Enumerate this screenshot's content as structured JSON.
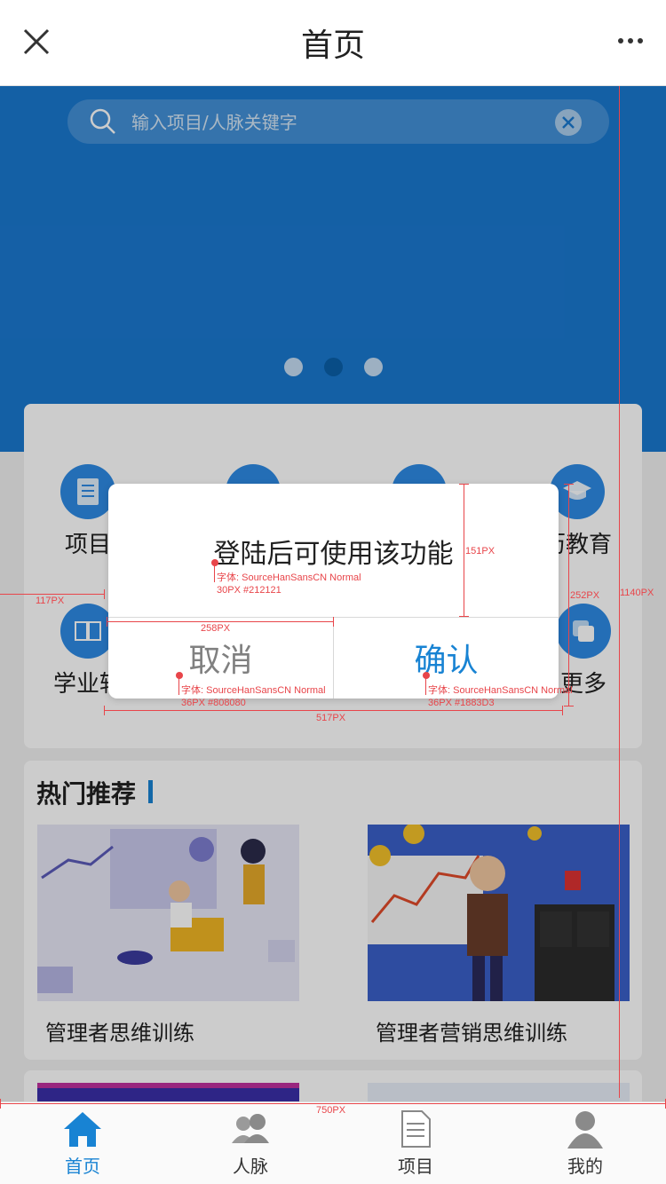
{
  "header": {
    "title": "首页",
    "close_icon": "close-icon",
    "more_icon": "more-dots-icon"
  },
  "search": {
    "placeholder": "输入项目/人脉关键字",
    "icon": "search-icon",
    "clear_icon": "clear-icon"
  },
  "carousel": {
    "dot_count": 3,
    "active_index": 1,
    "colors": {
      "banner": "#1a78cf",
      "active_dot": "#0a5fa8"
    }
  },
  "categories": [
    {
      "label": "项目"
    },
    {
      "label": ""
    },
    {
      "label": ""
    },
    {
      "label": "历教育"
    },
    {
      "label": "学业辅"
    },
    {
      "label": "更多"
    }
  ],
  "hot": {
    "title": "热门推荐",
    "items": [
      {
        "label": "管理者思维训练"
      },
      {
        "label": "管理者营销思维训练"
      }
    ]
  },
  "tabbar": {
    "items": [
      {
        "label": "首页",
        "icon": "home-icon",
        "active": true
      },
      {
        "label": "人脉",
        "icon": "contacts-icon",
        "active": false
      },
      {
        "label": "项目",
        "icon": "document-icon",
        "active": false
      },
      {
        "label": "我的",
        "icon": "user-icon",
        "active": false
      }
    ],
    "active_color": "#1883d3"
  },
  "dialog": {
    "message": "登陆后可使用该功能",
    "cancel_label": "取消",
    "confirm_label": "确认",
    "cancel_color": "#808080",
    "confirm_color": "#1883d3",
    "message_color": "#212121"
  },
  "annotations": {
    "msg_font": "字体: SourceHanSansCN Normal",
    "msg_spec": "30PX #212121",
    "cancel_font": "字体: SourceHanSansCN Normal",
    "cancel_spec": "36PX #808080",
    "confirm_font": "字体: SourceHanSansCN Normal",
    "confirm_spec": "36PX #1883D3",
    "dim_151": "151PX",
    "dim_252": "252PX",
    "dim_1140": "1140PX",
    "dim_117": "117PX",
    "dim_258": "258PX",
    "dim_517": "517PX",
    "dim_750": "750PX"
  }
}
